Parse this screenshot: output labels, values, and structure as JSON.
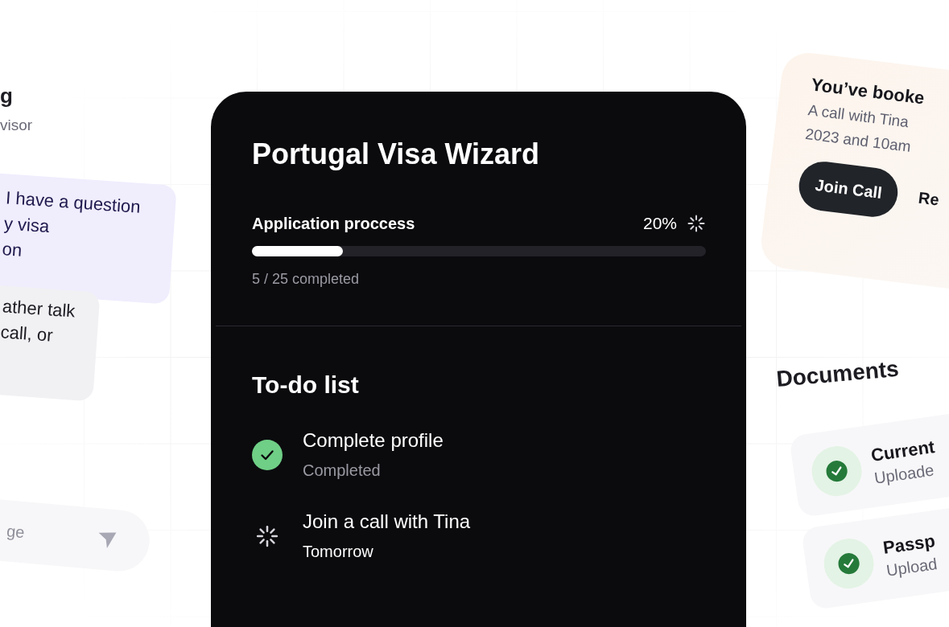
{
  "chat": {
    "name": "g",
    "role": "visor",
    "messages": [
      {
        "kind": "sent",
        "lines": [
          "I have a question",
          "y visa",
          "on"
        ]
      },
      {
        "kind": "received",
        "lines": [
          "ather talk",
          "call, or"
        ]
      }
    ],
    "input": {
      "placeholder": "ge"
    }
  },
  "wizard": {
    "title": "Portugal Visa Wizard",
    "progress": {
      "label": "Application proccess",
      "percent": "20%",
      "level": 0.2,
      "count": "5 / 25 completed"
    },
    "todo": {
      "title": "To-do list",
      "items": [
        {
          "title": "Complete profile",
          "status": "Completed",
          "done": true
        },
        {
          "title": "Join a call with Tina",
          "status": "Tomorrow",
          "done": false
        }
      ]
    }
  },
  "booking": {
    "title": "You’ve booke",
    "text_lines": [
      "A call with Tina",
      "2023 and 10am"
    ],
    "primary_button": "Join Call",
    "secondary_button": "Re"
  },
  "documents": {
    "title": "Documents",
    "items": [
      {
        "name": "Current",
        "status": "Uploade"
      },
      {
        "name": "Passp",
        "status": "Upload"
      }
    ]
  }
}
